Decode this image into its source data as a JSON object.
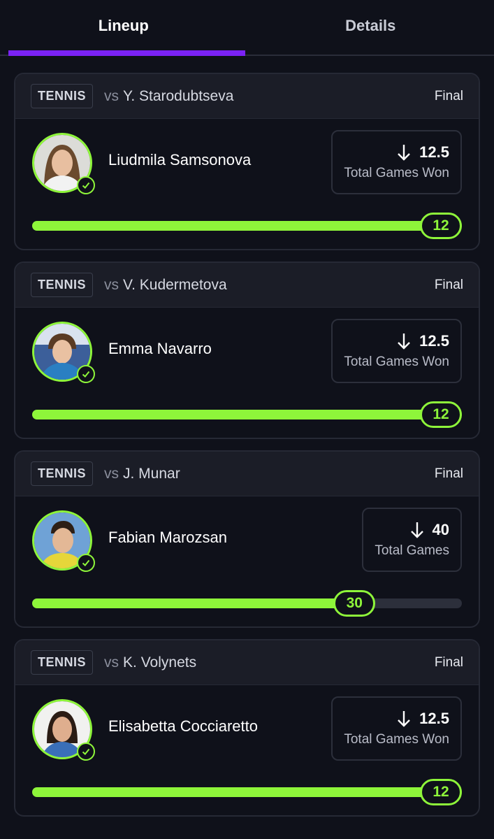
{
  "tabs": [
    {
      "label": "Lineup",
      "active": true
    },
    {
      "label": "Details",
      "active": false
    }
  ],
  "colors": {
    "accent": "#8ef53a",
    "tab_indicator": "#7b22f5",
    "background": "#0f111a"
  },
  "cards": [
    {
      "sport": "TENNIS",
      "vs": "vs",
      "opponent": "Y. Starodubtseva",
      "status": "Final",
      "player": "Liudmila Samsonova",
      "stat_icon": "arrow-down-icon",
      "line": "12.5",
      "stat_label": "Total Games Won",
      "progress": {
        "value": "12",
        "fraction": 1.0
      }
    },
    {
      "sport": "TENNIS",
      "vs": "vs",
      "opponent": "V. Kudermetova",
      "status": "Final",
      "player": "Emma Navarro",
      "stat_icon": "arrow-down-icon",
      "line": "12.5",
      "stat_label": "Total Games Won",
      "progress": {
        "value": "12",
        "fraction": 1.0
      }
    },
    {
      "sport": "TENNIS",
      "vs": "vs",
      "opponent": "J. Munar",
      "status": "Final",
      "player": "Fabian Marozsan",
      "stat_icon": "arrow-down-icon",
      "line": "40",
      "stat_label": "Total Games",
      "progress": {
        "value": "30",
        "fraction": 0.75
      }
    },
    {
      "sport": "TENNIS",
      "vs": "vs",
      "opponent": "K. Volynets",
      "status": "Final",
      "player": "Elisabetta Cocciaretto",
      "stat_icon": "arrow-down-icon",
      "line": "12.5",
      "stat_label": "Total Games Won",
      "progress": {
        "value": "12",
        "fraction": 1.0
      }
    }
  ]
}
